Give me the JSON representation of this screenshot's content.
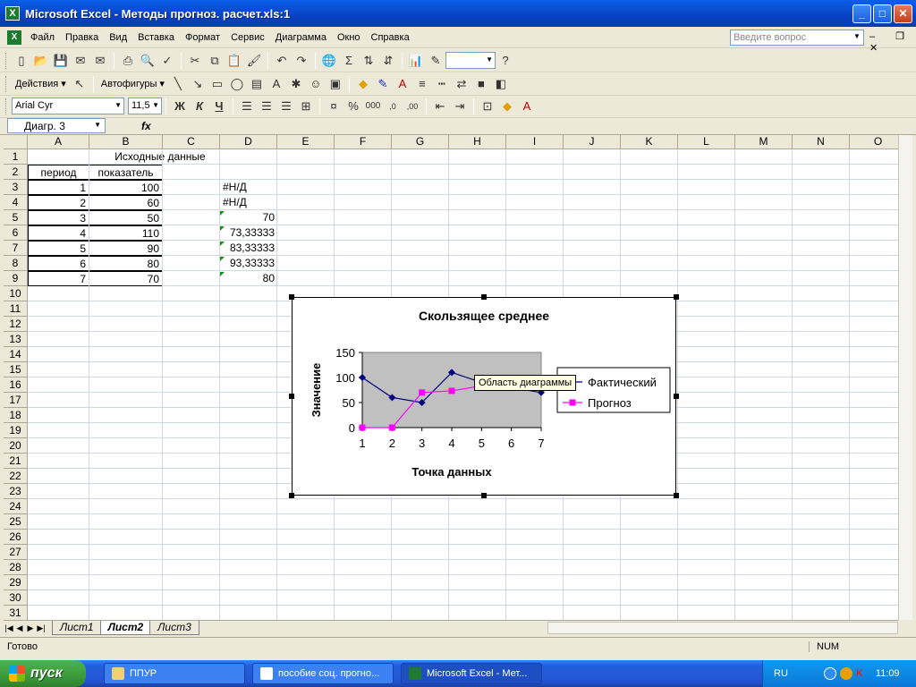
{
  "window": {
    "title": "Microsoft Excel - Методы прогноз. расчет.xls:1",
    "app_icon": "excel-icon"
  },
  "menu": {
    "items": [
      "Файл",
      "Правка",
      "Вид",
      "Вставка",
      "Формат",
      "Сервис",
      "Диаграмма",
      "Окно",
      "Справка"
    ],
    "ask_placeholder": "Введите вопрос"
  },
  "toolbar2": {
    "actions_label": "Действия ▾",
    "autoshapes_label": "Автофигуры ▾"
  },
  "format_toolbar": {
    "font": "Arial Cyr",
    "size": "11,5",
    "bold": "Ж",
    "italic": "К",
    "underline": "Ч"
  },
  "formula_bar": {
    "name_box": "Диагр. 3",
    "fx": "fx"
  },
  "columns": [
    "A",
    "B",
    "C",
    "D",
    "E",
    "F",
    "G",
    "H",
    "I",
    "J",
    "K",
    "L",
    "M",
    "N",
    "O"
  ],
  "rows": [
    "1",
    "2",
    "3",
    "4",
    "5",
    "6",
    "7",
    "8",
    "9",
    "10",
    "11",
    "12",
    "13",
    "14",
    "15",
    "16",
    "17",
    "18",
    "19",
    "20",
    "21",
    "22",
    "23",
    "24",
    "25",
    "26",
    "27",
    "28",
    "29",
    "30",
    "31"
  ],
  "sheet": {
    "title_cell": "Исходные данные",
    "header_a": "период",
    "header_b": "показатель",
    "period": [
      "1",
      "2",
      "3",
      "4",
      "5",
      "6",
      "7"
    ],
    "value": [
      "100",
      "60",
      "50",
      "110",
      "90",
      "80",
      "70"
    ],
    "d": [
      "#Н/Д",
      "#Н/Д",
      "70",
      "73,33333",
      "83,33333",
      "93,33333",
      "80"
    ]
  },
  "chart_data": {
    "type": "line",
    "title": "Скользящее среднее",
    "xlabel": "Точка данных",
    "ylabel": "Значение",
    "categories": [
      1,
      2,
      3,
      4,
      5,
      6,
      7
    ],
    "x_ticks": [
      "1",
      "2",
      "3",
      "4",
      "5",
      "6",
      "7"
    ],
    "y_ticks": [
      "0",
      "50",
      "100",
      "150"
    ],
    "ylim": [
      0,
      150
    ],
    "legend_position": "right",
    "plot_background": "#C0C0C0",
    "series": [
      {
        "name": "Фактический",
        "values": [
          100,
          60,
          50,
          110,
          90,
          80,
          70
        ],
        "color": "#000080",
        "marker": "diamond"
      },
      {
        "name": "Прогноз",
        "values": [
          0,
          0,
          70,
          73.33333,
          83.33333,
          93.33333,
          80
        ],
        "color": "#FF00FF",
        "marker": "square"
      }
    ]
  },
  "tooltip": "Область диаграммы",
  "sheet_tabs": [
    "Лист1",
    "Лист2",
    "Лист3"
  ],
  "active_tab": "Лист2",
  "status": {
    "left": "Готово",
    "num": "NUM"
  },
  "taskbar": {
    "start": "пуск",
    "tasks": [
      "ППУР",
      "пособие соц. прогно...",
      "Microsoft Excel - Мет..."
    ],
    "lang": "RU",
    "clock": "11:09"
  }
}
